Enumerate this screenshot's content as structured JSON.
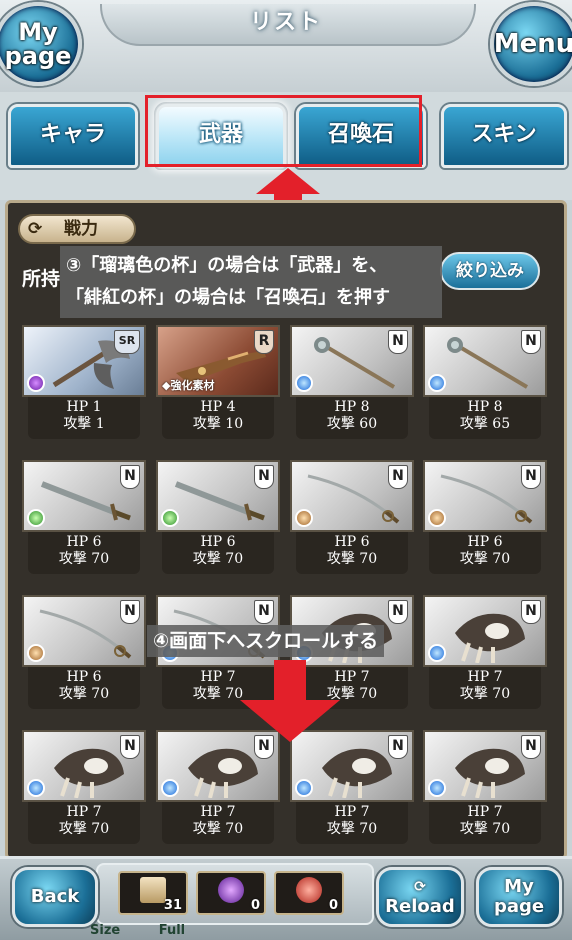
{
  "header": {
    "title": "リスト",
    "mypage_l1": "My",
    "mypage_l2": "page",
    "menu_label": "Menu"
  },
  "tabs": [
    {
      "label": "キャラ",
      "active": false
    },
    {
      "label": "武器",
      "active": true
    },
    {
      "label": "召喚石",
      "active": false
    },
    {
      "label": "スキン",
      "active": false
    }
  ],
  "toolbar": {
    "sort_label": "戦力",
    "owned_label": "所持",
    "filter_label": "絞り込み"
  },
  "annotations": {
    "note3_line1": "③「瑠璃色の杯」の場合は「武器」を、",
    "note3_line2": "「緋紅の杯」の場合は「召喚石」を押す",
    "note4": "④画面下へスクロールする"
  },
  "grid": [
    {
      "rarity": "SR",
      "element": "dark",
      "hp": "HP 1",
      "atk": "攻撃 1",
      "weapon": "axe"
    },
    {
      "rarity": "R",
      "element": "",
      "boost": "強化素材",
      "hp": "HP 4",
      "atk": "攻撃 10",
      "weapon": "gun"
    },
    {
      "rarity": "N",
      "element": "water",
      "hp": "HP 8",
      "atk": "攻撃 60",
      "weapon": "staff"
    },
    {
      "rarity": "N",
      "element": "water",
      "hp": "HP 8",
      "atk": "攻撃 65",
      "weapon": "staff"
    },
    {
      "rarity": "N",
      "element": "wind",
      "hp": "HP 6",
      "atk": "攻撃 70",
      "weapon": "sword"
    },
    {
      "rarity": "N",
      "element": "wind",
      "hp": "HP 6",
      "atk": "攻撃 70",
      "weapon": "sword"
    },
    {
      "rarity": "N",
      "element": "earth",
      "hp": "HP 6",
      "atk": "攻撃 70",
      "weapon": "saber"
    },
    {
      "rarity": "N",
      "element": "earth",
      "hp": "HP 6",
      "atk": "攻撃 70",
      "weapon": "saber"
    },
    {
      "rarity": "N",
      "element": "earth",
      "hp": "HP 6",
      "atk": "攻撃 70",
      "weapon": "saber"
    },
    {
      "rarity": "N",
      "element": "water",
      "hp": "HP 7",
      "atk": "攻撃 70",
      "weapon": "saber"
    },
    {
      "rarity": "N",
      "element": "water",
      "hp": "HP 7",
      "atk": "攻撃 70",
      "weapon": "claw"
    },
    {
      "rarity": "N",
      "element": "water",
      "hp": "HP 7",
      "atk": "攻撃 70",
      "weapon": "claw"
    },
    {
      "rarity": "N",
      "element": "water",
      "hp": "HP 7",
      "atk": "攻撃 70",
      "weapon": "claw"
    },
    {
      "rarity": "N",
      "element": "water",
      "hp": "HP 7",
      "atk": "攻撃 70",
      "weapon": "claw"
    },
    {
      "rarity": "N",
      "element": "water",
      "hp": "HP 7",
      "atk": "攻撃 70",
      "weapon": "claw"
    },
    {
      "rarity": "N",
      "element": "water",
      "hp": "HP 7",
      "atk": "攻撃 70",
      "weapon": "claw"
    }
  ],
  "bottom": {
    "back_label": "Back",
    "reload_label": "Reload",
    "mypage_l1": "My",
    "mypage_l2": "page",
    "items": [
      {
        "icon": "scroll-icon",
        "count": "31"
      },
      {
        "icon": "dark-orb-icon",
        "count": "0"
      },
      {
        "icon": "red-gem-icon",
        "count": "0"
      }
    ],
    "size_label": "Size",
    "full_label": "Full"
  },
  "colors": {
    "highlight": "#e3202a",
    "arrow": "#e3202a"
  }
}
